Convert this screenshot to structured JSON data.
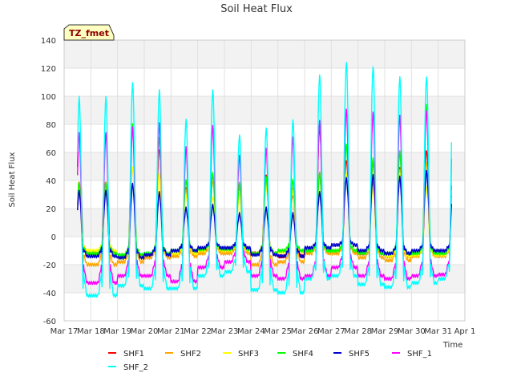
{
  "chart_data": {
    "type": "line",
    "title": "Soil Heat Flux",
    "xlabel": "Time",
    "ylabel": "Soil Heat Flux",
    "badge": "TZ_fmet",
    "ylim": [
      -60,
      140
    ],
    "yticks": [
      -60,
      -40,
      -20,
      0,
      20,
      40,
      60,
      80,
      100,
      120,
      140
    ],
    "xlim": [
      "2024-03-17",
      "2024-04-01"
    ],
    "xticks": [
      "Mar 17",
      "Mar 18",
      "Mar 19",
      "Mar 20",
      "Mar 21",
      "Mar 22",
      "Mar 23",
      "Mar 24",
      "Mar 25",
      "Mar 26",
      "Mar 27",
      "Mar 28",
      "Mar 29",
      "Mar 30",
      "Mar 31",
      "Apr 1"
    ],
    "grid": true,
    "legend_position": "bottom",
    "x_start": "2024-03-17 12:00",
    "x_end": "2024-03-31 12:00",
    "series": [
      {
        "name": "SHF1",
        "color": "#ff0000",
        "daily_max": [
          74,
          78,
          63,
          36,
          44,
          38,
          45,
          30,
          77,
          55,
          53,
          50,
          62,
          47
        ],
        "daily_min": [
          -12,
          -14,
          -13,
          -12,
          -10,
          -10,
          -12,
          -14,
          -11,
          -11,
          -12,
          -14,
          -13,
          -13
        ]
      },
      {
        "name": "SHF2",
        "color": "#ffa500",
        "daily_max": [
          40,
          49,
          44,
          34,
          40,
          35,
          40,
          35,
          44,
          44,
          39,
          48,
          53,
          45
        ],
        "daily_min": [
          -20,
          -18,
          -15,
          -14,
          -12,
          -12,
          -20,
          -18,
          -12,
          -12,
          -15,
          -17,
          -14,
          -14
        ]
      },
      {
        "name": "SHF3",
        "color": "#ffff00",
        "daily_max": [
          35,
          50,
          45,
          30,
          28,
          32,
          36,
          33,
          45,
          45,
          35,
          45,
          35,
          45
        ],
        "daily_min": [
          -10,
          -15,
          -13,
          -12,
          -10,
          -10,
          -12,
          -11,
          -10,
          -10,
          -12,
          -14,
          -13,
          -13
        ]
      },
      {
        "name": "SHF4",
        "color": "#00ff00",
        "daily_max": [
          38,
          80,
          70,
          40,
          45,
          38,
          42,
          40,
          45,
          65,
          55,
          60,
          93,
          55
        ],
        "daily_min": [
          -12,
          -13,
          -12,
          -10,
          -9,
          -9,
          -12,
          -10,
          -10,
          -10,
          -12,
          -12,
          -12,
          -12
        ]
      },
      {
        "name": "SHF5",
        "color": "#0000cd",
        "daily_max": [
          32,
          37,
          31,
          20,
          22,
          16,
          20,
          16,
          31,
          41,
          43,
          42,
          46,
          35
        ],
        "daily_min": [
          -14,
          -15,
          -13,
          -10,
          -8,
          -8,
          -13,
          -14,
          -8,
          -6,
          -10,
          -12,
          -10,
          -10
        ]
      },
      {
        "name": "SHF_1",
        "color": "#ff00ff",
        "daily_max": [
          73,
          77,
          80,
          63,
          78,
          57,
          62,
          70,
          82,
          90,
          88,
          86,
          89,
          86
        ],
        "daily_min": [
          -33,
          -28,
          -28,
          -32,
          -22,
          -18,
          -28,
          -30,
          -28,
          -22,
          -28,
          -30,
          -28,
          -27
        ]
      },
      {
        "name": "SHF_2",
        "color": "#00ffff",
        "daily_max": [
          99,
          109,
          104,
          83,
          104,
          72,
          77,
          83,
          115,
          124,
          121,
          114,
          114,
          104
        ],
        "daily_min": [
          -42,
          -35,
          -37,
          -37,
          -28,
          -25,
          -38,
          -40,
          -30,
          -28,
          -34,
          -36,
          -33,
          -30
        ]
      }
    ]
  }
}
